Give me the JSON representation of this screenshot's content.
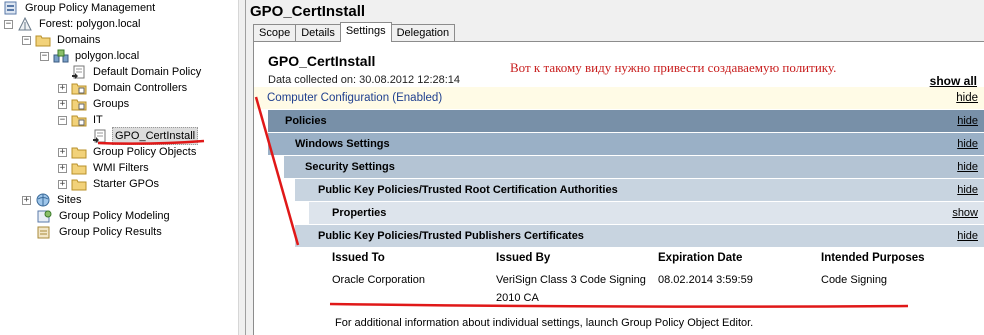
{
  "tree": {
    "items": [
      {
        "label": "Group Policy Management",
        "expander": "",
        "icon": "gpm-icon"
      },
      {
        "label": "Forest: polygon.local",
        "expander": "−",
        "icon": "forest-icon"
      },
      {
        "label": "Domains",
        "expander": "−",
        "icon": "folder-icon"
      },
      {
        "label": "polygon.local",
        "expander": "−",
        "icon": "domain-icon"
      },
      {
        "label": "Default Domain Policy",
        "expander": "",
        "icon": "gpo-link-icon"
      },
      {
        "label": "Domain Controllers",
        "expander": "+",
        "icon": "ou-icon"
      },
      {
        "label": "Groups",
        "expander": "+",
        "icon": "ou-icon"
      },
      {
        "label": "IT",
        "expander": "−",
        "icon": "ou-icon"
      },
      {
        "label": "GPO_CertInstall",
        "expander": "",
        "icon": "gpo-link-icon",
        "selected": true
      },
      {
        "label": "Group Policy Objects",
        "expander": "+",
        "icon": "folder-icon"
      },
      {
        "label": "WMI Filters",
        "expander": "+",
        "icon": "folder-icon"
      },
      {
        "label": "Starter GPOs",
        "expander": "+",
        "icon": "folder-icon"
      },
      {
        "label": "Sites",
        "expander": "+",
        "icon": "sites-icon"
      },
      {
        "label": "Group Policy Modeling",
        "expander": "",
        "icon": "modeling-icon"
      },
      {
        "label": "Group Policy Results",
        "expander": "",
        "icon": "results-icon"
      }
    ]
  },
  "pane": {
    "title": "GPO_CertInstall",
    "tabs": [
      "Scope",
      "Details",
      "Settings",
      "Delegation"
    ],
    "active_tab": "Settings"
  },
  "report": {
    "title": "GPO_CertInstall",
    "collected": "Data collected on: 30.08.2012 12:28:14",
    "show_all": "show all",
    "computer_config": "Computer Configuration (Enabled)",
    "sections": {
      "computer": {
        "link": "hide"
      },
      "policies": {
        "label": "Policies",
        "link": "hide"
      },
      "windows": {
        "label": "Windows Settings",
        "link": "hide"
      },
      "security": {
        "label": "Security Settings",
        "link": "hide"
      },
      "pkp_root": {
        "label": "Public Key Policies/Trusted Root Certification Authorities",
        "link": "hide"
      },
      "properties": {
        "label": "Properties",
        "link": "show"
      },
      "pkp_pub": {
        "label": "Public Key Policies/Trusted Publishers Certificates",
        "link": "hide"
      }
    },
    "table": {
      "headers": [
        "Issued To",
        "Issued By",
        "Expiration Date",
        "Intended Purposes"
      ],
      "row": [
        "Oracle Corporation",
        "VeriSign Class 3 Code Signing\n2010 CA",
        "08.02.2014 3:59:59",
        "Code Signing"
      ]
    },
    "footnote": "For additional information about individual settings, launch Group Policy Object Editor."
  },
  "annotation": {
    "text": "Вот к такому виду нужно привести создаваемую политику.",
    "color": "#c81e1e"
  }
}
